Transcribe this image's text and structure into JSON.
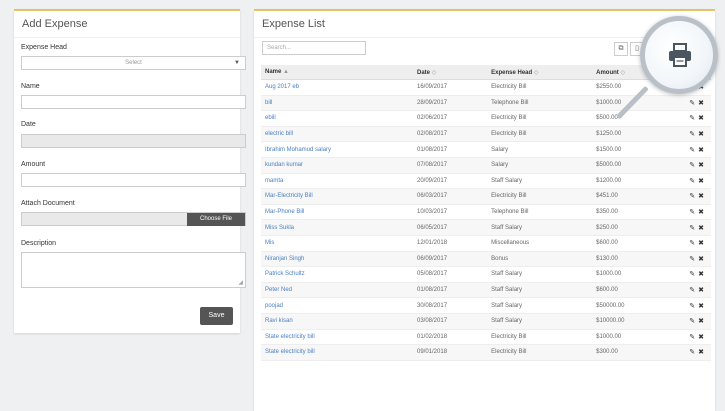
{
  "add_expense": {
    "title": "Add Expense",
    "expense_head_label": "Expense Head",
    "expense_head_value": "Select",
    "name_label": "Name",
    "date_label": "Date",
    "amount_label": "Amount",
    "attach_label": "Attach Document",
    "choose_file": "Choose File",
    "description_label": "Description",
    "save_label": "Save"
  },
  "expense_list": {
    "title": "Expense List",
    "search_placeholder": "Search...",
    "columns": [
      "Name",
      "Date",
      "Expense Head",
      "Amount"
    ],
    "rows": [
      {
        "name": "Aug 2017 eb",
        "date": "16/09/2017",
        "head": "Electricity Bill",
        "amount": "$2550.00"
      },
      {
        "name": "bill",
        "date": "28/09/2017",
        "head": "Telephone Bill",
        "amount": "$1000.00"
      },
      {
        "name": "ebill",
        "date": "02/06/2017",
        "head": "Electricity Bill",
        "amount": "$500.00"
      },
      {
        "name": "electric bill",
        "date": "02/08/2017",
        "head": "Electricity Bill",
        "amount": "$1250.00"
      },
      {
        "name": "Ibrahim Mohamud salary",
        "date": "01/08/2017",
        "head": "Salary",
        "amount": "$1500.00"
      },
      {
        "name": "kundan kumar",
        "date": "07/08/2017",
        "head": "Salary",
        "amount": "$5000.00"
      },
      {
        "name": "mamta",
        "date": "20/09/2017",
        "head": "Staff Salary",
        "amount": "$1200.00"
      },
      {
        "name": "Mar-Electricity Bill",
        "date": "06/03/2017",
        "head": "Electricity Bill",
        "amount": "$451.00"
      },
      {
        "name": "Mar-Phone Bill",
        "date": "10/03/2017",
        "head": "Telephone Bill",
        "amount": "$350.00"
      },
      {
        "name": "Miss Sukla",
        "date": "06/05/2017",
        "head": "Staff Salary",
        "amount": "$250.00"
      },
      {
        "name": "Mis",
        "date": "12/01/2018",
        "head": "Miscellaneous",
        "amount": "$600.00"
      },
      {
        "name": "Niranjan Singh",
        "date": "06/09/2017",
        "head": "Bonus",
        "amount": "$130.00"
      },
      {
        "name": "Patrick Schultz",
        "date": "05/08/2017",
        "head": "Staff Salary",
        "amount": "$1000.00"
      },
      {
        "name": "Peter Ned",
        "date": "01/08/2017",
        "head": "Staff Salary",
        "amount": "$600.00"
      },
      {
        "name": "poojad",
        "date": "30/08/2017",
        "head": "Staff Salary",
        "amount": "$50000.00"
      },
      {
        "name": "Ravi kisan",
        "date": "03/08/2017",
        "head": "Staff Salary",
        "amount": "$10000.00"
      },
      {
        "name": "State electricity bill",
        "date": "01/02/2018",
        "head": "Electricity Bill",
        "amount": "$1000.00"
      },
      {
        "name": "State electricity bill",
        "date": "09/01/2018",
        "head": "Electricity Bill",
        "amount": "$300.00"
      }
    ]
  },
  "icons": {
    "magnifier": "printer-icon",
    "edit": "pencil-icon",
    "delete": "close-icon"
  }
}
